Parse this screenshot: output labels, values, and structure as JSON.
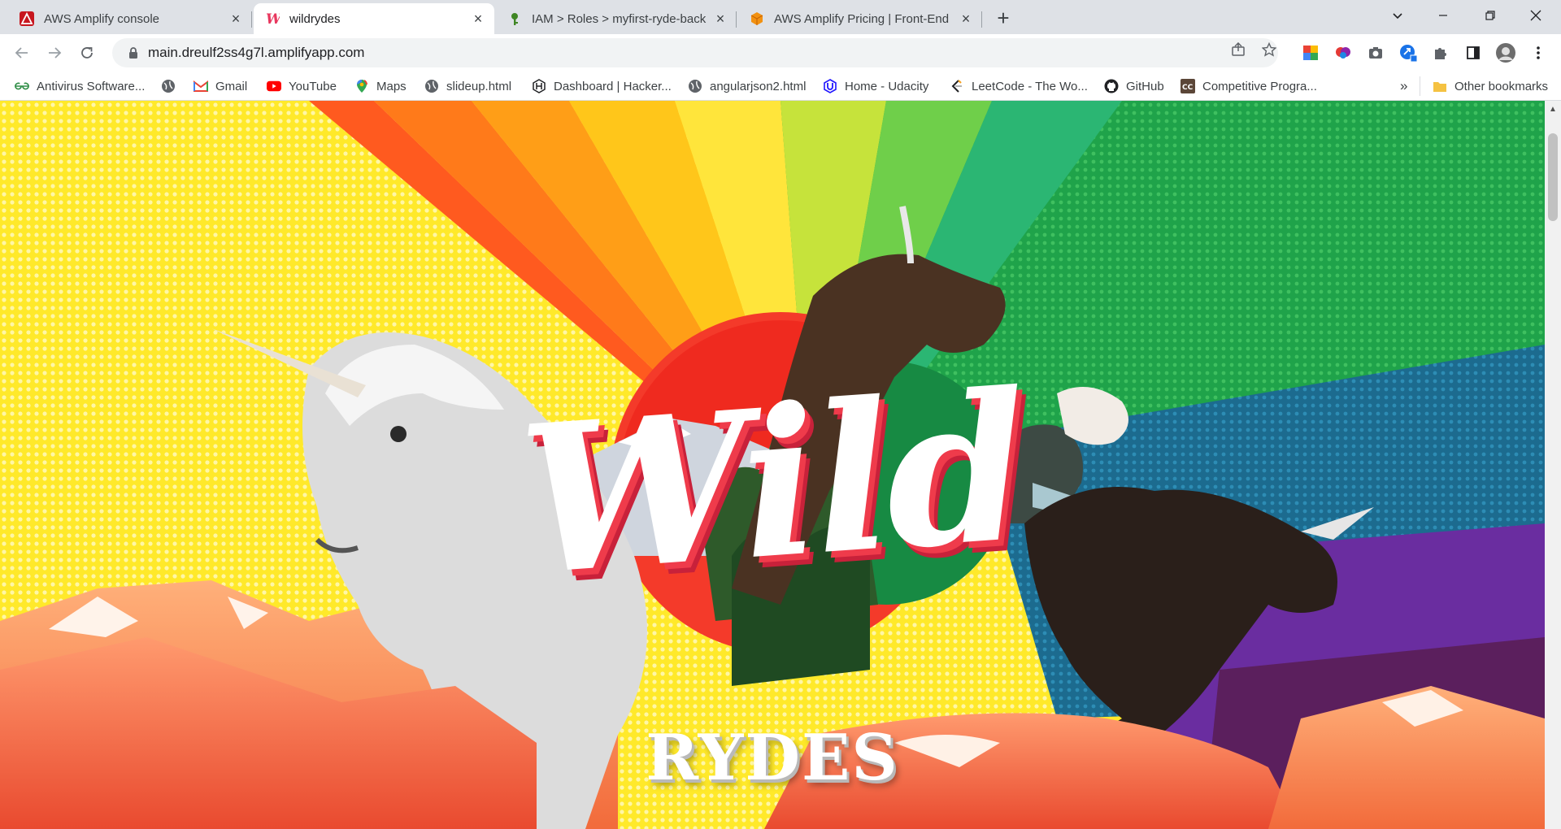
{
  "browser": {
    "tabs": [
      {
        "title": "AWS Amplify console",
        "icon": "aws-amplify-icon",
        "active": false
      },
      {
        "title": "wildrydes",
        "icon": "wildrydes-w-icon",
        "active": true
      },
      {
        "title": "IAM > Roles > myfirst-ryde-back",
        "icon": "iam-key-icon",
        "active": false
      },
      {
        "title": "AWS Amplify Pricing | Front-End",
        "icon": "aws-box-icon",
        "active": false
      }
    ],
    "url": "main.dreulf2ss4g7l.amplifyapp.com",
    "bookmarks": [
      {
        "label": "Antivirus Software...",
        "icon": "gfg-icon"
      },
      {
        "label": "",
        "icon": "globe-icon"
      },
      {
        "label": "Gmail",
        "icon": "gmail-icon"
      },
      {
        "label": "YouTube",
        "icon": "youtube-icon"
      },
      {
        "label": "Maps",
        "icon": "maps-icon"
      },
      {
        "label": "slideup.html",
        "icon": "globe-icon"
      },
      {
        "label": "Dashboard | Hacker...",
        "icon": "hackerrank-icon"
      },
      {
        "label": "angularjson2.html",
        "icon": "globe-icon"
      },
      {
        "label": "Home - Udacity",
        "icon": "udacity-icon"
      },
      {
        "label": "LeetCode - The Wo...",
        "icon": "leetcode-icon"
      },
      {
        "label": "GitHub",
        "icon": "github-icon"
      },
      {
        "label": "Competitive Progra...",
        "icon": "cc-icon"
      }
    ],
    "overflow_label": "»",
    "other_bookmarks": "Other bookmarks",
    "new_tab_symbol": "+",
    "tab_close_symbol": "×",
    "colors": {
      "tabstrip": "#dee1e6",
      "omnibox": "#f1f3f4",
      "accent_red": "#ef3b4b"
    }
  },
  "page": {
    "hero": {
      "title_script": "Wild",
      "title_block": "RYDES"
    }
  }
}
